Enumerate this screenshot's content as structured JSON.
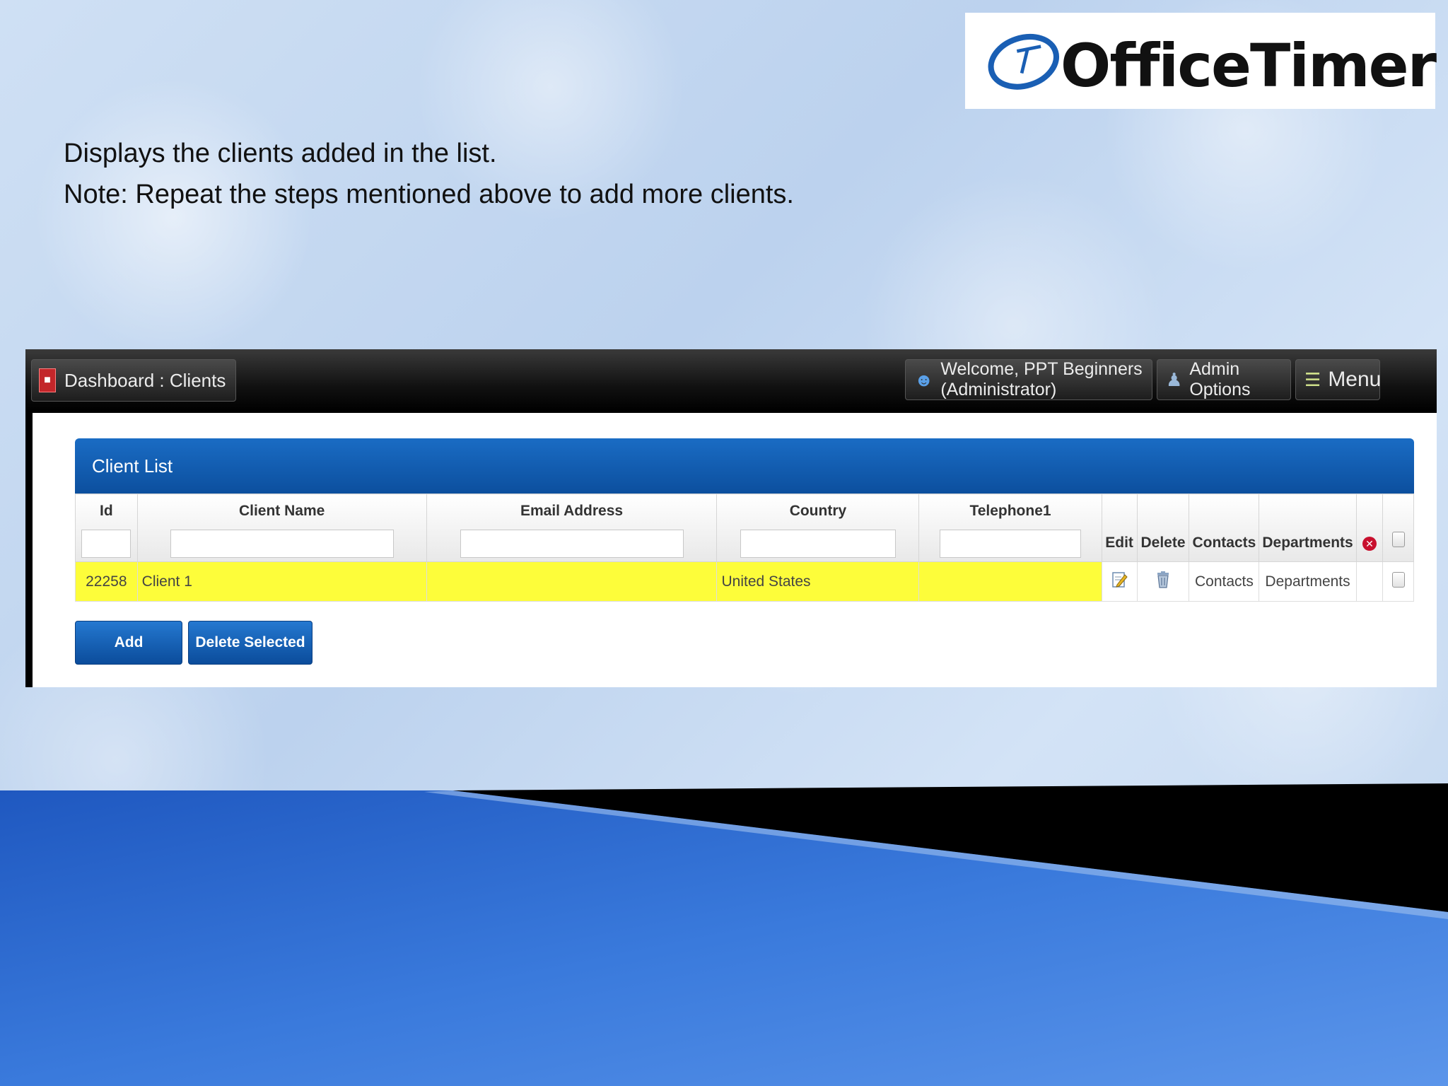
{
  "brand": {
    "name": "OfficeTimer"
  },
  "intro": {
    "line1": "Displays the clients added in the list.",
    "line2": "Note:  Repeat the steps mentioned above to add more clients."
  },
  "topbar": {
    "breadcrumb": "Dashboard : Clients",
    "welcome": "Welcome, PPT Beginners (Administrator)",
    "admin_options": "Admin Options",
    "menu": "Menu"
  },
  "panel": {
    "title": "Client List",
    "columns": {
      "id": "Id",
      "client_name": "Client Name",
      "email": "Email Address",
      "country": "Country",
      "telephone": "Telephone1",
      "edit": "Edit",
      "delete": "Delete",
      "contacts": "Contacts",
      "departments": "Departments"
    },
    "rows": [
      {
        "id": "22258",
        "client_name": "Client 1",
        "email": "",
        "country": "United States",
        "telephone": "",
        "contacts": "Contacts",
        "departments": "Departments"
      }
    ],
    "buttons": {
      "add": "Add",
      "delete_selected": "Delete Selected"
    }
  },
  "colors": {
    "header_blue": "#0c4f9e",
    "row_highlight": "#fdfd3a",
    "bottom_band": "#2f6fd4"
  }
}
